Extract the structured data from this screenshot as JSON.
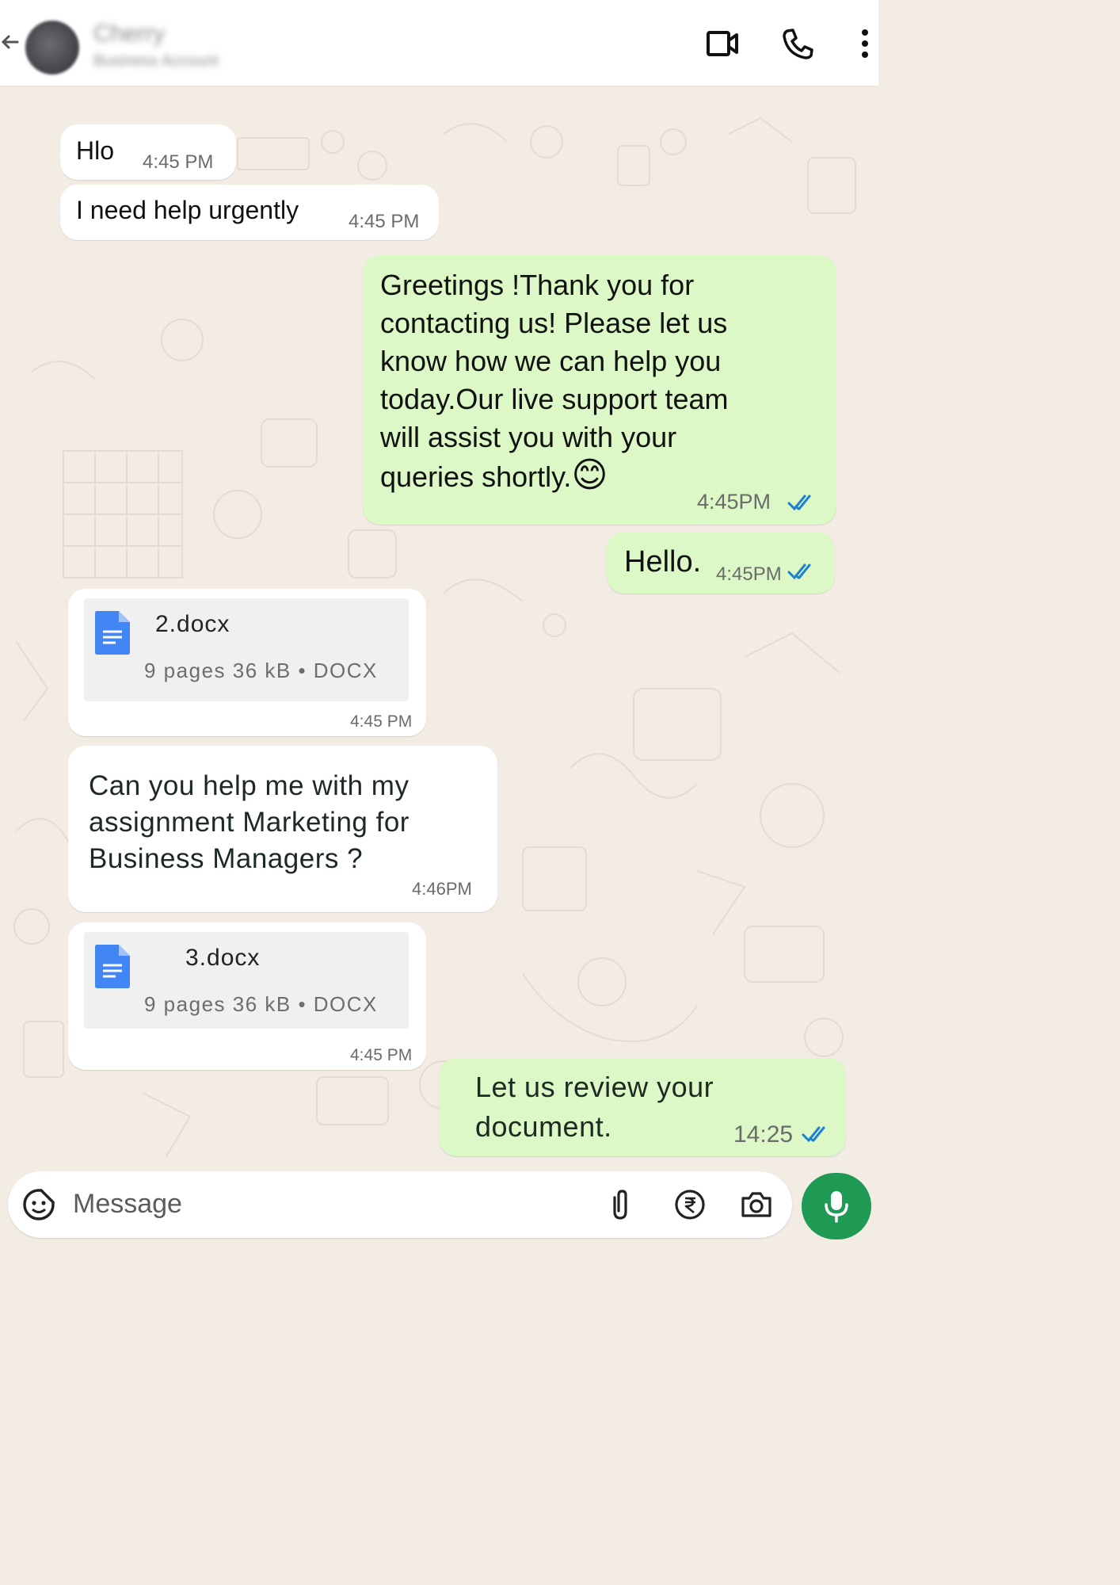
{
  "header": {
    "contact_name": "Cherry",
    "contact_status": "Business Account",
    "icons": [
      "back-arrow-icon",
      "video-call-icon",
      "voice-call-icon",
      "more-options-icon"
    ]
  },
  "messages": [
    {
      "text": "Hlo",
      "time": "4:45 PM",
      "from": "contact"
    },
    {
      "text": "I need help urgently",
      "time": "4:45 PM",
      "from": "contact"
    },
    {
      "lines": [
        "Greetings !Thank you for",
        "contacting us! Please let us",
        "know how we can help you",
        "today.Our live support team",
        "will assist you with your",
        "queries shortly."
      ],
      "emoji": "😊",
      "time": "4:45PM",
      "from": "me",
      "status": "read"
    },
    {
      "text": "Hello.",
      "time": "4:45PM",
      "from": "me",
      "status": "read"
    },
    {
      "doc_name": "2.docx",
      "doc_meta": "9 pages 36 kB • DOCX",
      "time": "4:45 PM",
      "from": "contact"
    },
    {
      "lines": [
        "Can you help me with my",
        "assignment Marketing for",
        "Business Managers ?"
      ],
      "time": "4:46PM",
      "from": "contact"
    },
    {
      "doc_name": "3.docx",
      "doc_meta": "9 pages 36 kB • DOCX",
      "time": "4:45 PM",
      "from": "contact"
    },
    {
      "lines": [
        "Let us review your",
        "document."
      ],
      "time": "14:25",
      "from": "me",
      "status": "read"
    }
  ],
  "composer": {
    "placeholder": "Message",
    "icons": [
      "emoji-sticker-icon",
      "attach-icon",
      "payment-rupee-icon",
      "camera-icon",
      "microphone-icon"
    ]
  },
  "colors": {
    "chat_background": "#f2ece4",
    "incoming_bubble": "#ffffff",
    "outgoing_bubble": "#dbf8c6",
    "read_ticks": "#1f7fd1",
    "mic_button": "#1f9a55",
    "doc_icon": "#4285f4"
  }
}
